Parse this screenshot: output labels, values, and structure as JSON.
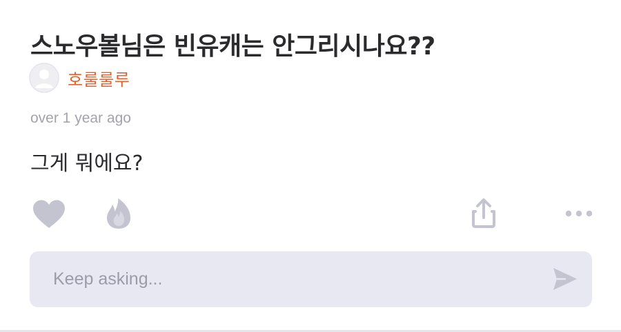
{
  "post": {
    "title": "스노우볼님은 빈유캐는 안그리시나요??",
    "author": "호룰룰루",
    "timestamp": "over 1 year ago",
    "body": "그게 뭐에요?"
  },
  "actions": {
    "like_icon": "heart-icon",
    "fire_icon": "flame-icon",
    "share_icon": "share-icon",
    "more_icon": "more-dots-icon"
  },
  "composer": {
    "placeholder": "Keep asking...",
    "value": "",
    "send_icon": "send-icon"
  },
  "colors": {
    "accent": "#e2632f",
    "title": "#2b2b2e",
    "muted": "#a3a3aa",
    "icon": "#c4c4d0",
    "composer_bg": "#e8e8f2"
  }
}
